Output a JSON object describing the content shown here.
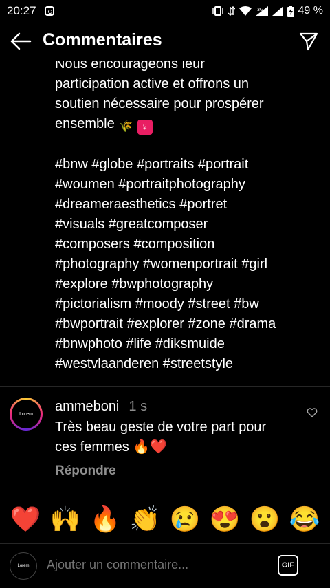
{
  "status_bar": {
    "time": "20:27",
    "battery": "49 %",
    "network": "3G"
  },
  "header": {
    "title": "Commentaires"
  },
  "caption": {
    "lines_top": [
      "Nous encourageons leur",
      "participation active et offrons un",
      "soutien nécessaire pour prospérer",
      "ensemble"
    ],
    "hashtags": [
      "#bnw #globe #portraits #portrait",
      "#woumen #portraitphotography",
      "#dreameraesthetics #portret",
      "#visuals #greatcomposer",
      "#composers #composition",
      "#photography #womenportrait #girl",
      "#explore #bwphotography",
      "#pictorialism #moody #street #bw",
      "#bwportrait #explorer #zone #drama",
      "#bnwphoto #life #diksmuide",
      "#westvlaanderen #streetstyle"
    ]
  },
  "comment": {
    "username": "ammeboni",
    "time": "1 s",
    "line1": "Très beau geste de votre part pour",
    "line2": "ces femmes 🔥❤️",
    "reply": "Répondre",
    "avatar_text": "Lorem"
  },
  "reactions": [
    "❤️",
    "🙌",
    "🔥",
    "👏",
    "😢",
    "😍",
    "😮",
    "😂"
  ],
  "composer": {
    "placeholder": "Ajouter un commentaire...",
    "gif": "GIF",
    "avatar_text": "Lorem"
  }
}
